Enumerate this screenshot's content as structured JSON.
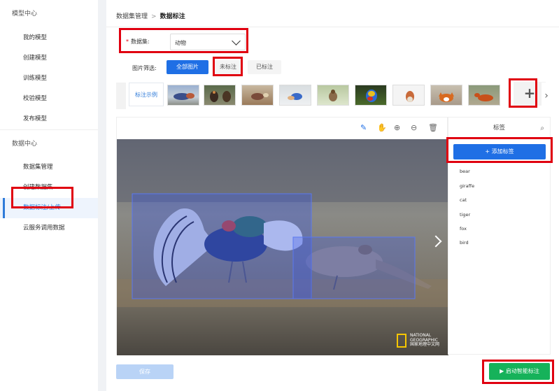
{
  "sidebar": {
    "sections": [
      {
        "title": "模型中心",
        "items": [
          "我的模型",
          "创建模型",
          "训练模型",
          "校验模型",
          "发布模型"
        ]
      },
      {
        "title": "数据中心",
        "items": [
          "数据集管理",
          "创建数据集",
          "数据标注/上传",
          "云服务调用数据"
        ]
      }
    ],
    "active_item": "数据标注/上传"
  },
  "breadcrumb": {
    "parent": "数据集管理",
    "separator": ">",
    "current": "数据标注"
  },
  "dataset": {
    "label": "数据集:",
    "required_mark": "*",
    "value": "动物"
  },
  "filter": {
    "label": "图片筛选:",
    "options": [
      "全部图片",
      "未标注",
      "已标注"
    ],
    "selected": "全部图片"
  },
  "thumbnails": {
    "sample_label": "标注示例",
    "add_symbol": "+",
    "next_symbol": "›"
  },
  "tools": {
    "edit_icon": "✎",
    "hand_icon": "✋",
    "zoom_in_icon": "⊕",
    "zoom_out_icon": "⊖",
    "delete_icon": "🗑"
  },
  "image_overlay": {
    "brand_line1": "NATIONAL",
    "brand_line2": "GEOGRAPHIC",
    "brand_line3": "国家地理中文网"
  },
  "labels_panel": {
    "title": "标签",
    "add_button": "+ 添加标签",
    "tags": [
      "bear",
      "giraffe",
      "cat",
      "tiger",
      "fox",
      "bird"
    ]
  },
  "footer": {
    "save_label": "保存",
    "auto_label": "▶ 启动智能标注"
  },
  "colors": {
    "primary": "#1f6fe5",
    "highlight_box": "#e00010",
    "success": "#16b25a",
    "bbox_fill": "#4a6be0"
  }
}
